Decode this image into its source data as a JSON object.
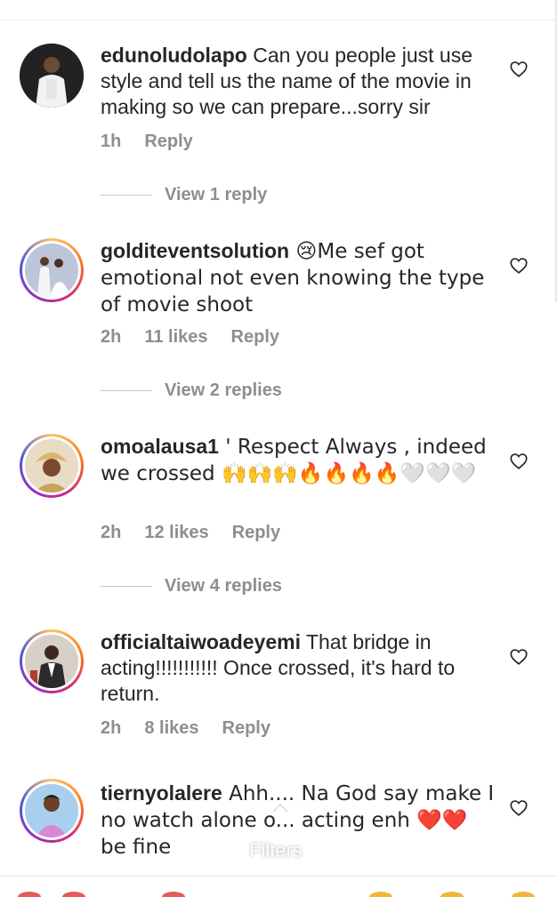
{
  "comments": [
    {
      "username": "edunoludolapo",
      "text": " Can you people just use style and tell us the name of the movie in making so we can prepare...sorry sir",
      "time": "1h",
      "likes": "",
      "reply": "Reply",
      "view_replies": "View 1 reply",
      "story_ring": false
    },
    {
      "username": "golditeventsolution",
      "text": " 😢Me sef got emotional not even knowing the type of movie shoot",
      "time": "2h",
      "likes": "11 likes",
      "reply": "Reply",
      "view_replies": "View 2 replies",
      "story_ring": true
    },
    {
      "username": "omoalausa1",
      "text": " ' Respect Always , indeed we crossed 🙌🙌🙌🔥🔥🔥🔥🤍🤍🤍",
      "time": "2h",
      "likes": "12 likes",
      "reply": "Reply",
      "view_replies": "View 4 replies",
      "story_ring": true
    },
    {
      "username": "officialtaiwoadeyemi",
      "text": " That bridge in acting!!!!!!!!!!! Once crossed, it's hard to return.",
      "time": "2h",
      "likes": "8 likes",
      "reply": "Reply",
      "view_replies": "",
      "story_ring": true
    },
    {
      "username": "tiernyolalere",
      "text": " Ahh.... Na God say make I no watch alone o... acting enh ❤️❤️ be fine",
      "time": "",
      "likes": "",
      "reply": "",
      "view_replies": "",
      "story_ring": true
    }
  ],
  "overlay": {
    "filters_label": "Filters"
  },
  "icons": {
    "like": "heart-outline-icon",
    "expand": "chevron-up-icon"
  },
  "colors": {
    "text": "#262626",
    "muted": "#8e8e8e",
    "story_ring": "#d62976"
  }
}
